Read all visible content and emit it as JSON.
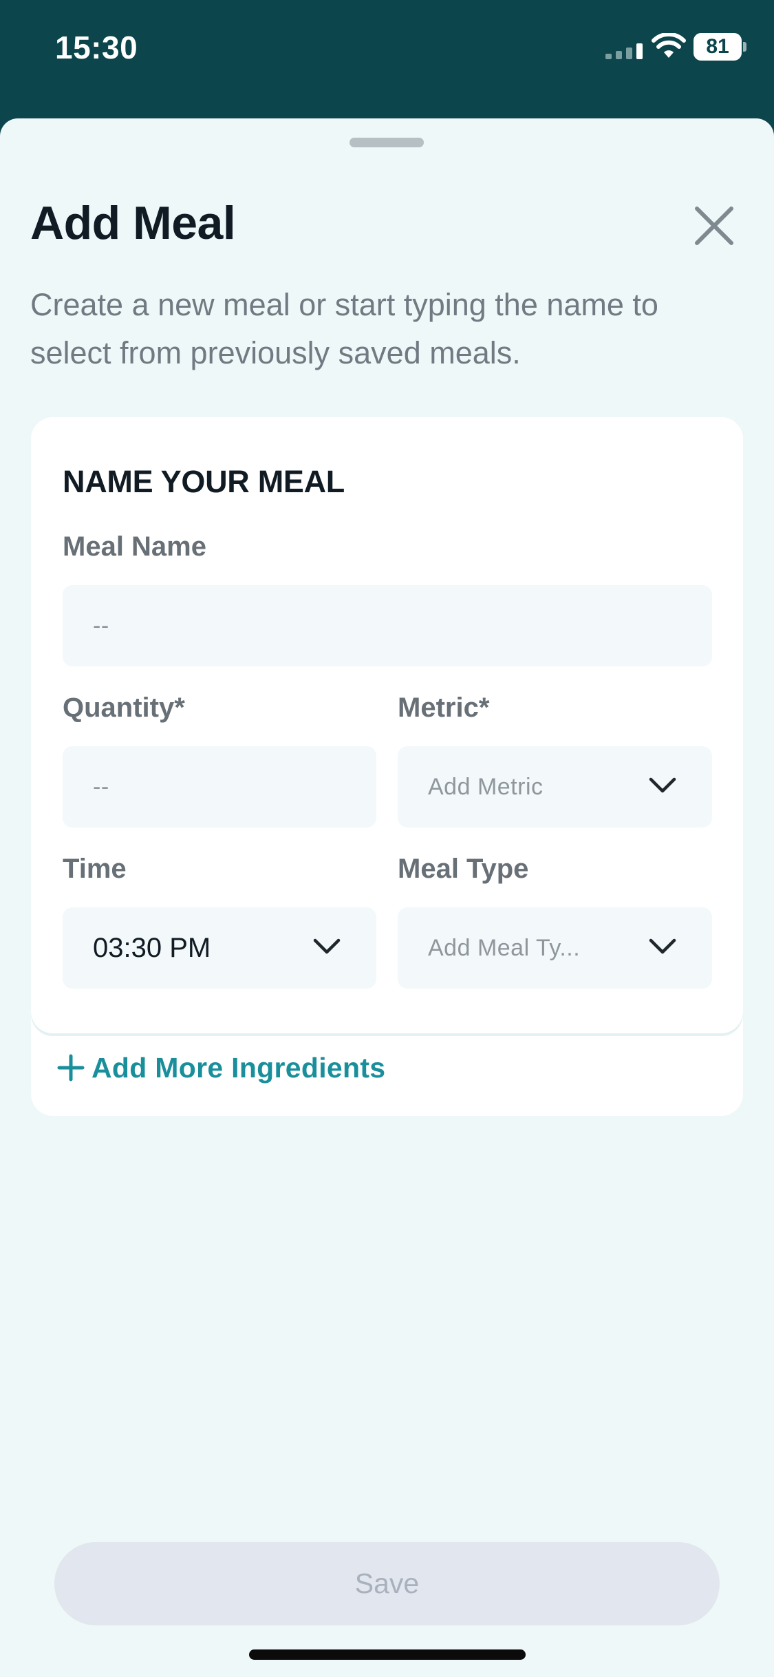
{
  "status_bar": {
    "time": "15:30",
    "battery_level": "81"
  },
  "sheet": {
    "title": "Add Meal",
    "subtitle": "Create a new meal or start typing the name to select from previously saved meals."
  },
  "form": {
    "heading": "NAME YOUR MEAL",
    "meal_name": {
      "label": "Meal Name",
      "placeholder": "--"
    },
    "quantity": {
      "label": "Quantity*",
      "placeholder": "--"
    },
    "metric": {
      "label": "Metric*",
      "placeholder": "Add Metric"
    },
    "time": {
      "label": "Time",
      "value": "03:30 PM"
    },
    "meal_type": {
      "label": "Meal Type",
      "placeholder": "Add Meal Ty..."
    },
    "add_more_label": "Add More Ingredients"
  },
  "footer": {
    "save_label": "Save"
  },
  "colors": {
    "header_bg": "#0c454b",
    "sheet_bg": "#eef8f9",
    "accent": "#1a8f9c",
    "save_disabled_bg": "#e2e6ee"
  }
}
